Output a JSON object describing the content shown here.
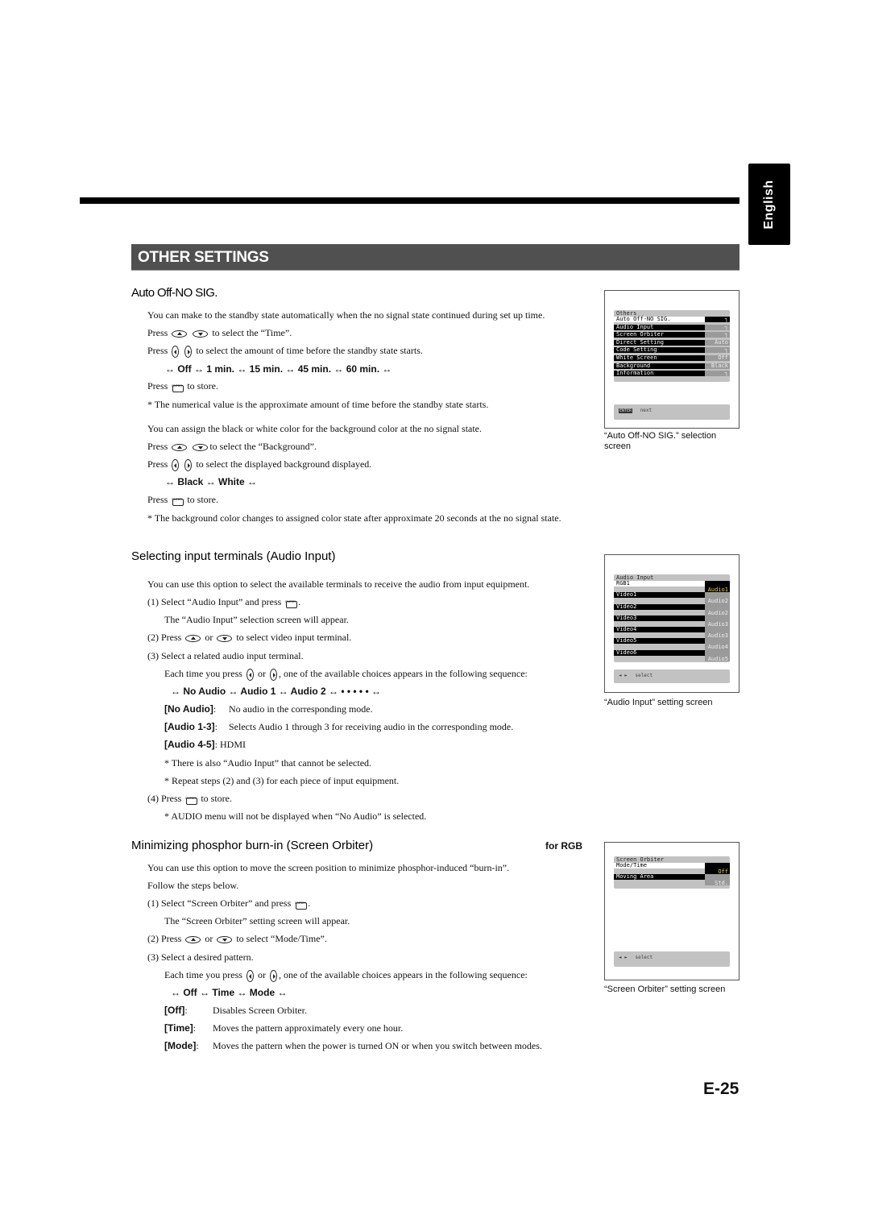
{
  "language_tab": "English",
  "section_title": "OTHER SETTINGS",
  "page_number": "E-25",
  "auto_off": {
    "heading": "Auto Off-NO SIG.",
    "intro": "You can make to the standby state automatically when the no signal state continued during set up time.",
    "press_label": "Press",
    "select_time": "to select the “Time”.",
    "select_amount": "to select the amount of time before the standby state starts.",
    "time_sequence": "↔ Off ↔ 1 min. ↔ 15 min. ↔ 45 min. ↔ 60 min. ↔",
    "store": "to store.",
    "note1": "* The numerical value is the approximate amount of time before the standby state starts.",
    "bg_intro": "You can assign the black or white color for the background color at the no signal state.",
    "select_background": "to select the “Background”.",
    "select_displayed_bg": "to select the displayed background displayed.",
    "bg_sequence": "↔ Black ↔ White ↔",
    "note2": "* The background color changes to assigned color state after approximate 20 seconds at the no signal state.",
    "figure_caption": "“Auto Off-NO SIG.” selection screen",
    "osd": {
      "title": "Others",
      "rows": [
        {
          "label": "Auto Off-NO SIG.",
          "value": "┐",
          "selected": true
        },
        {
          "label": "Audio Input",
          "value": "┐"
        },
        {
          "label": "Screen Orbiter",
          "value": "┐"
        },
        {
          "label": "Direct Setting",
          "value": "Auto"
        },
        {
          "label": "Code Setting",
          "value": "┐"
        },
        {
          "label": "White Screen",
          "value": "Off"
        },
        {
          "label": "Background",
          "value": "Black"
        },
        {
          "label": "Information",
          "value": "┐"
        }
      ],
      "footer_key": "ENTER",
      "footer_text": "next"
    }
  },
  "audio_input": {
    "heading": "Selecting input terminals (Audio Input)",
    "intro": "You can use this option to select the available terminals to receive the audio from input equipment.",
    "step1_num": "(1)",
    "step1": "Select “Audio Input” and press",
    "step1_sub": "The “Audio Input” selection screen will appear.",
    "step2_num": "(2)",
    "step2_press": "Press",
    "step2_or": "or",
    "step2": "to select video input terminal.",
    "step3_num": "(3)",
    "step3": "Select a related audio input terminal.",
    "step3_each": "Each time you press",
    "step3_or": "or",
    "step3_tail": ", one of the available choices appears in the following sequence:",
    "sequence": "↔ No Audio ↔ Audio 1 ↔ Audio 2 ↔ •  •  •  •  • ↔",
    "defs": [
      {
        "term": "[No Audio]",
        "desc": "No audio in the corresponding mode."
      },
      {
        "term": "[Audio 1-3]",
        "desc": "Selects Audio 1 through 3 for receiving audio in the corresponding mode."
      },
      {
        "term": "[Audio 4-5]",
        "desc": "HDMI"
      }
    ],
    "note1": "* There is also “Audio Input” that cannot be selected.",
    "note2": "* Repeat steps (2) and (3) for each piece of input equipment.",
    "step4_num": "(4)",
    "step4_press": "Press",
    "step4": "to store.",
    "note3": "* AUDIO menu will not be displayed when “No Audio” is selected.",
    "figure_caption": "“Audio Input” setting screen",
    "osd": {
      "title": "Audio Input",
      "rows": [
        {
          "label": "RGB1",
          "value": "Audio1",
          "selected": true
        },
        {
          "label": "Video1",
          "value": "Audio2"
        },
        {
          "label": "Video2",
          "value": "Audio2"
        },
        {
          "label": "Video3",
          "value": "Audio3"
        },
        {
          "label": "Video4",
          "value": "Audio3"
        },
        {
          "label": "Video5",
          "value": "Audio4"
        },
        {
          "label": "Video6",
          "value": "Audio5"
        }
      ],
      "footer_key": "◄ ►",
      "footer_text": "select"
    }
  },
  "screen_orbiter": {
    "heading": "Minimizing phosphor burn-in (Screen Orbiter)",
    "badge": "for RGB",
    "intro": "You can use this option to move the screen position to minimize phosphor-induced “burn-in”.",
    "follow": "Follow the steps below.",
    "step1_num": "(1)",
    "step1": "Select “Screen Orbiter” and press",
    "step1_sub": "The “Screen Orbiter” setting screen will appear.",
    "step2_num": "(2)",
    "step2_press": "Press",
    "step2_or": "or",
    "step2": "to select “Mode/Time”.",
    "step3_num": "(3)",
    "step3": "Select a desired pattern.",
    "step3_each": "Each time you press",
    "step3_or": "or",
    "step3_tail": ", one of the available choices appears in the following sequence:",
    "sequence": "↔ Off ↔ Time ↔ Mode ↔",
    "defs": [
      {
        "term": "[Off]",
        "desc": "Disables Screen Orbiter."
      },
      {
        "term": "[Time]",
        "desc": "Moves the pattern approximately every one hour."
      },
      {
        "term": "[Mode]",
        "desc": "Moves the pattern when the power is turned ON or when you switch between modes."
      }
    ],
    "figure_caption": "“Screen Orbiter” setting screen",
    "osd": {
      "title": "Screen Orbiter",
      "rows": [
        {
          "label": "Mode/Time",
          "value": "Off",
          "selected": true
        },
        {
          "label": "Moving Area",
          "value": "Std."
        }
      ],
      "footer_key": "◄ ►",
      "footer_text": "select"
    }
  }
}
